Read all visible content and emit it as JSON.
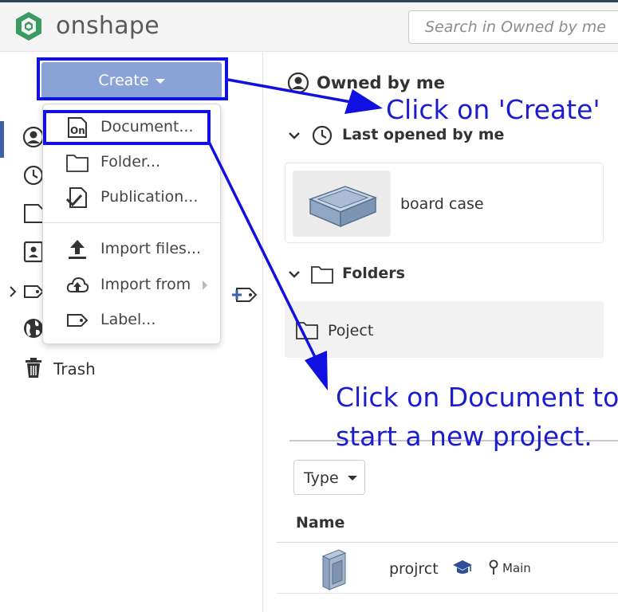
{
  "app": {
    "brand": "onshape",
    "brand_color": "#3a9a5f"
  },
  "search": {
    "placeholder": "Search in Owned by me"
  },
  "sidebar": {
    "create_label": "Create",
    "trash_label": "Trash",
    "nav_icons": [
      "person-circle-icon",
      "clock-icon",
      "document-icon",
      "contact-card-icon",
      "label-icon",
      "globe-icon",
      "trash-icon"
    ]
  },
  "create_menu": {
    "items": [
      {
        "label": "Document...",
        "icon": "onshape-document-icon"
      },
      {
        "label": "Folder...",
        "icon": "folder-icon"
      },
      {
        "label": "Publication...",
        "icon": "publication-icon"
      },
      {
        "label": "Import files...",
        "icon": "upload-icon"
      },
      {
        "label": "Import from",
        "icon": "cloud-upload-icon"
      },
      {
        "label": "Label...",
        "icon": "label-icon"
      }
    ]
  },
  "main": {
    "title": "Owned by me",
    "recent_section": {
      "title": "Last opened by me",
      "items": [
        {
          "name": "board case"
        }
      ]
    },
    "folders_section": {
      "title": "Folders",
      "items": [
        {
          "name": "Poject"
        }
      ]
    },
    "filter": {
      "type_label": "Type"
    },
    "table": {
      "column_name": "Name",
      "rows": [
        {
          "name": "projrct",
          "branch": "Main"
        }
      ]
    }
  },
  "annotations": {
    "create_hint": "Click on 'Create'",
    "document_hint_line1": "Click on Document to",
    "document_hint_line2": "start a new project.",
    "color": "#1010e0"
  }
}
